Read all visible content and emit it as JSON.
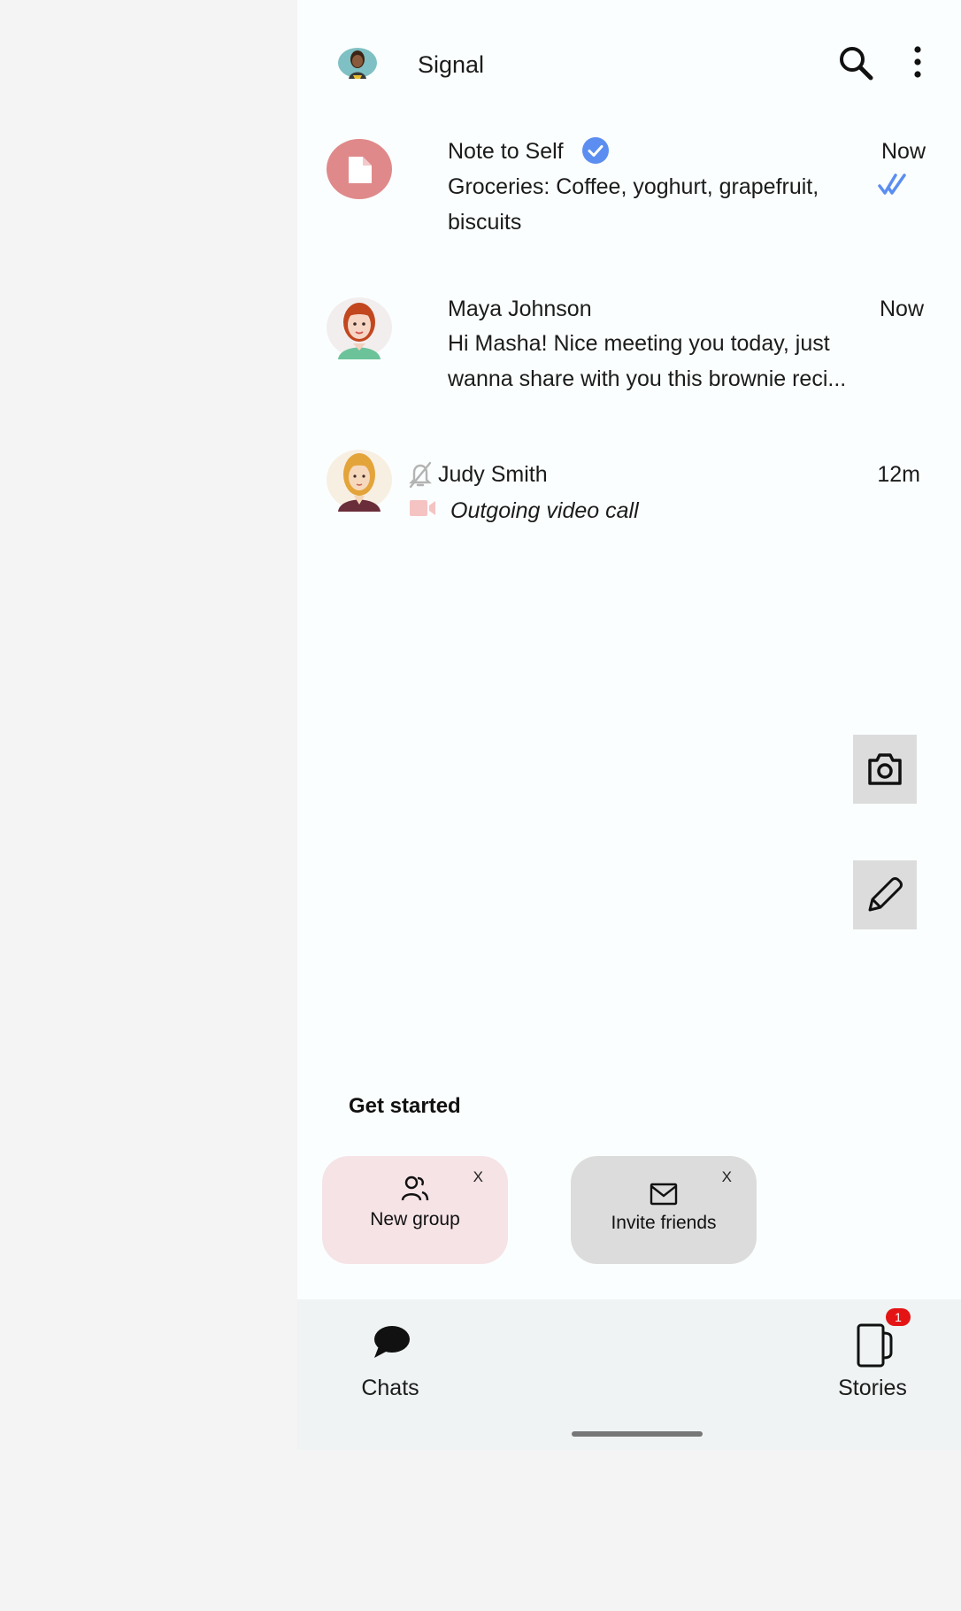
{
  "header": {
    "title": "Signal",
    "icons": [
      "profile-avatar",
      "search-icon",
      "more-vert-icon"
    ]
  },
  "chats": [
    {
      "name": "Note to Self",
      "time": "Now",
      "message": "Groceries: Coffee, yoghurt, grapefruit, biscuits",
      "verified": true,
      "status": "read",
      "avatar_color": "#e0898a"
    },
    {
      "name": "Maya Johnson",
      "time": "Now",
      "message": "Hi Masha! Nice meeting you today, just wanna share with you this brownie reci..."
    },
    {
      "name": "Judy Smith",
      "time": "12m",
      "message": "Outgoing video call",
      "muted": true
    }
  ],
  "fabs": [
    "camera-icon",
    "pencil-icon"
  ],
  "get_started": {
    "title": "Get started",
    "cards": [
      {
        "label": "New group",
        "close": "X",
        "bg": "#f5e3e6"
      },
      {
        "label": "Invite friends",
        "close": "X",
        "bg": "#dcdcdc"
      }
    ]
  },
  "nav": {
    "chats_label": "Chats",
    "stories_label": "Stories",
    "stories_badge": "1"
  },
  "colors": {
    "background": "#fbfefe",
    "accent_blue": "#5b8ef0",
    "badge_red": "#e41414",
    "bottom_nav": "#eff3f3"
  }
}
